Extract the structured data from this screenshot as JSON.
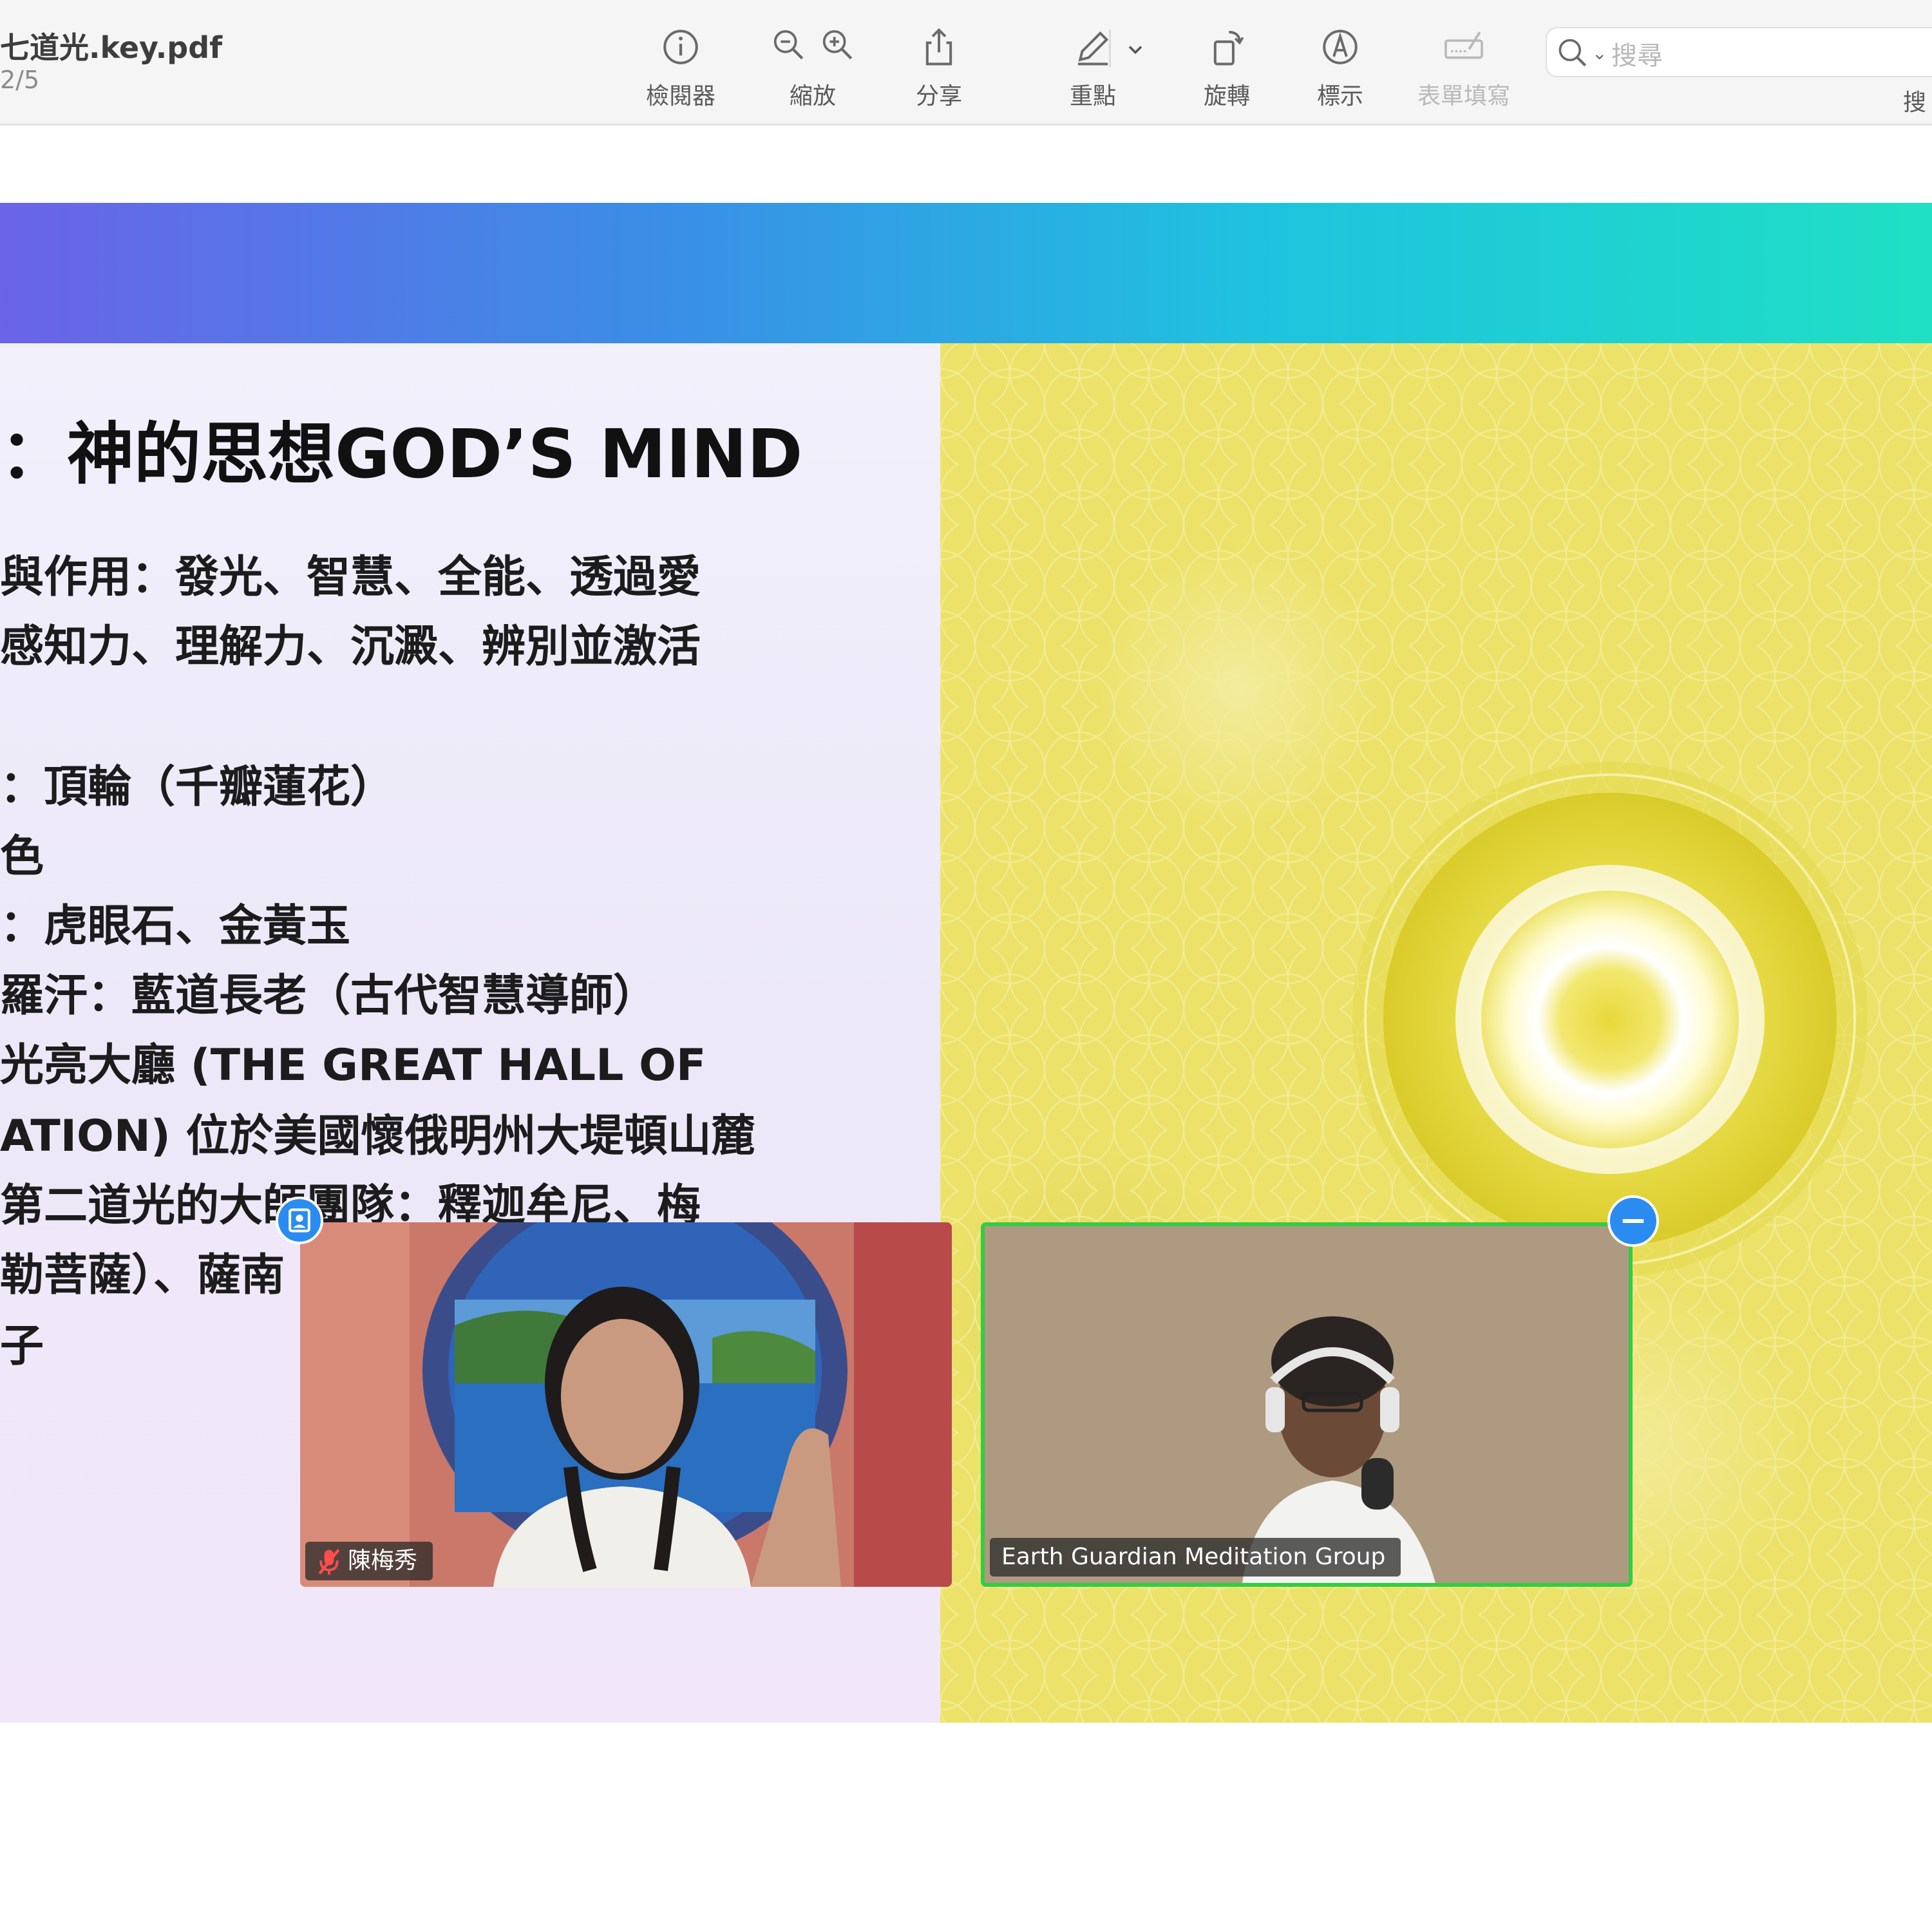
{
  "toolbar": {
    "doc_title": "七道光.key.pdf",
    "page_indicator": "2/5",
    "inspector_label": "檢閱器",
    "zoom_label": "縮放",
    "share_label": "分享",
    "highlight_label": "重點",
    "rotate_label": "旋轉",
    "markup_label": "標示",
    "form_fill_label": "表單填寫",
    "search_placeholder": "搜尋",
    "search_cut_label": "搜"
  },
  "icons": {
    "inspector": "info-icon",
    "zoom_out": "zoom-out-icon",
    "zoom_in": "zoom-in-icon",
    "share": "share-icon",
    "highlight": "pen-icon",
    "highlight_menu": "chevron-down-icon",
    "rotate": "rotate-icon",
    "markup": "markup-pen-icon",
    "form_fill": "form-signature-icon",
    "search": "magnifier-icon",
    "participant_badge": "person-card-icon",
    "minimize": "minus-icon",
    "muted": "mic-muted-icon"
  },
  "slide": {
    "title": "：神的思想GOD’S MIND",
    "lines": [
      "與作用：發光、智慧、全能、透過愛",
      "感知力、理解力、沉澱、辨別並激活",
      "：頂輪（千瓣蓮花）",
      "色",
      "：虎眼石、金黃玉",
      "羅汗：藍道長老（古代智慧導師）",
      "光亮大廳 (THE GREAT HALL OF",
      "ATION) 位於美國懷俄明州大堤頓山麓",
      "第二道光的大師團隊：釋迦牟尼、梅",
      "勒菩薩）、薩南",
      "子"
    ]
  },
  "video": {
    "participant_a": "陳梅秀",
    "participant_b": "Earth Guardian Meditation Group"
  },
  "colors": {
    "banner_start": "#6b63e8",
    "banner_end": "#1fe0c4",
    "slide_yellow": "#ece26a",
    "active_speaker_border": "#33cc44",
    "badge_blue": "#2a8cf0"
  }
}
